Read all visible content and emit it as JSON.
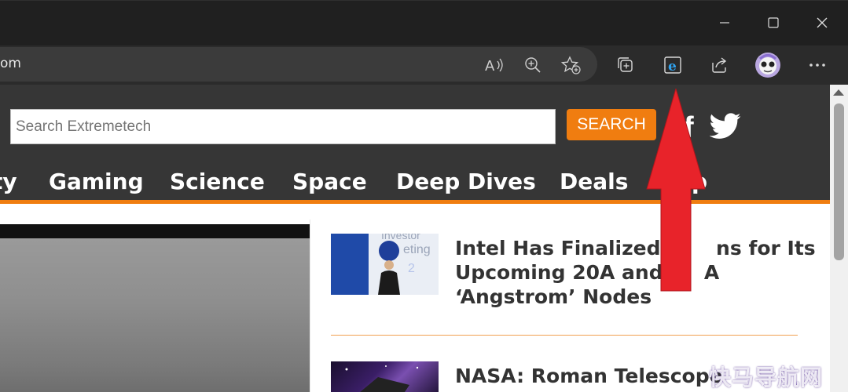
{
  "browser": {
    "url_fragment": "om",
    "window_controls": [
      "minimize",
      "maximize",
      "close"
    ],
    "toolbar_icons": [
      "read-aloud-icon",
      "zoom-icon",
      "add-favorite-icon",
      "collections-icon",
      "ie-mode-icon",
      "share-icon",
      "profile-avatar",
      "more-icon"
    ]
  },
  "site": {
    "search_placeholder": "Search Extremetech",
    "search_button": "SEARCH",
    "social": {
      "facebook": "f"
    },
    "nav": [
      "ty",
      "Gaming",
      "Science",
      "Space",
      "Deep Dives",
      "Deals",
      "p"
    ]
  },
  "articles": [
    {
      "title_lines": [
        "Intel Has Finalized P     ns for Its",
        "Upcoming 20A and 1   A",
        "‘Angstrom’ Nodes"
      ],
      "thumb_text": [
        "Investor",
        "eting",
        "2"
      ]
    },
    {
      "title_lines": [
        "NASA: Roman Telescope"
      ]
    }
  ],
  "overlay": {
    "watermark": "快马导航网",
    "arrow_color": "#e8232a"
  },
  "colors": {
    "accent": "#f07d10",
    "header_bg": "#363636",
    "browser_bg": "#202020"
  }
}
